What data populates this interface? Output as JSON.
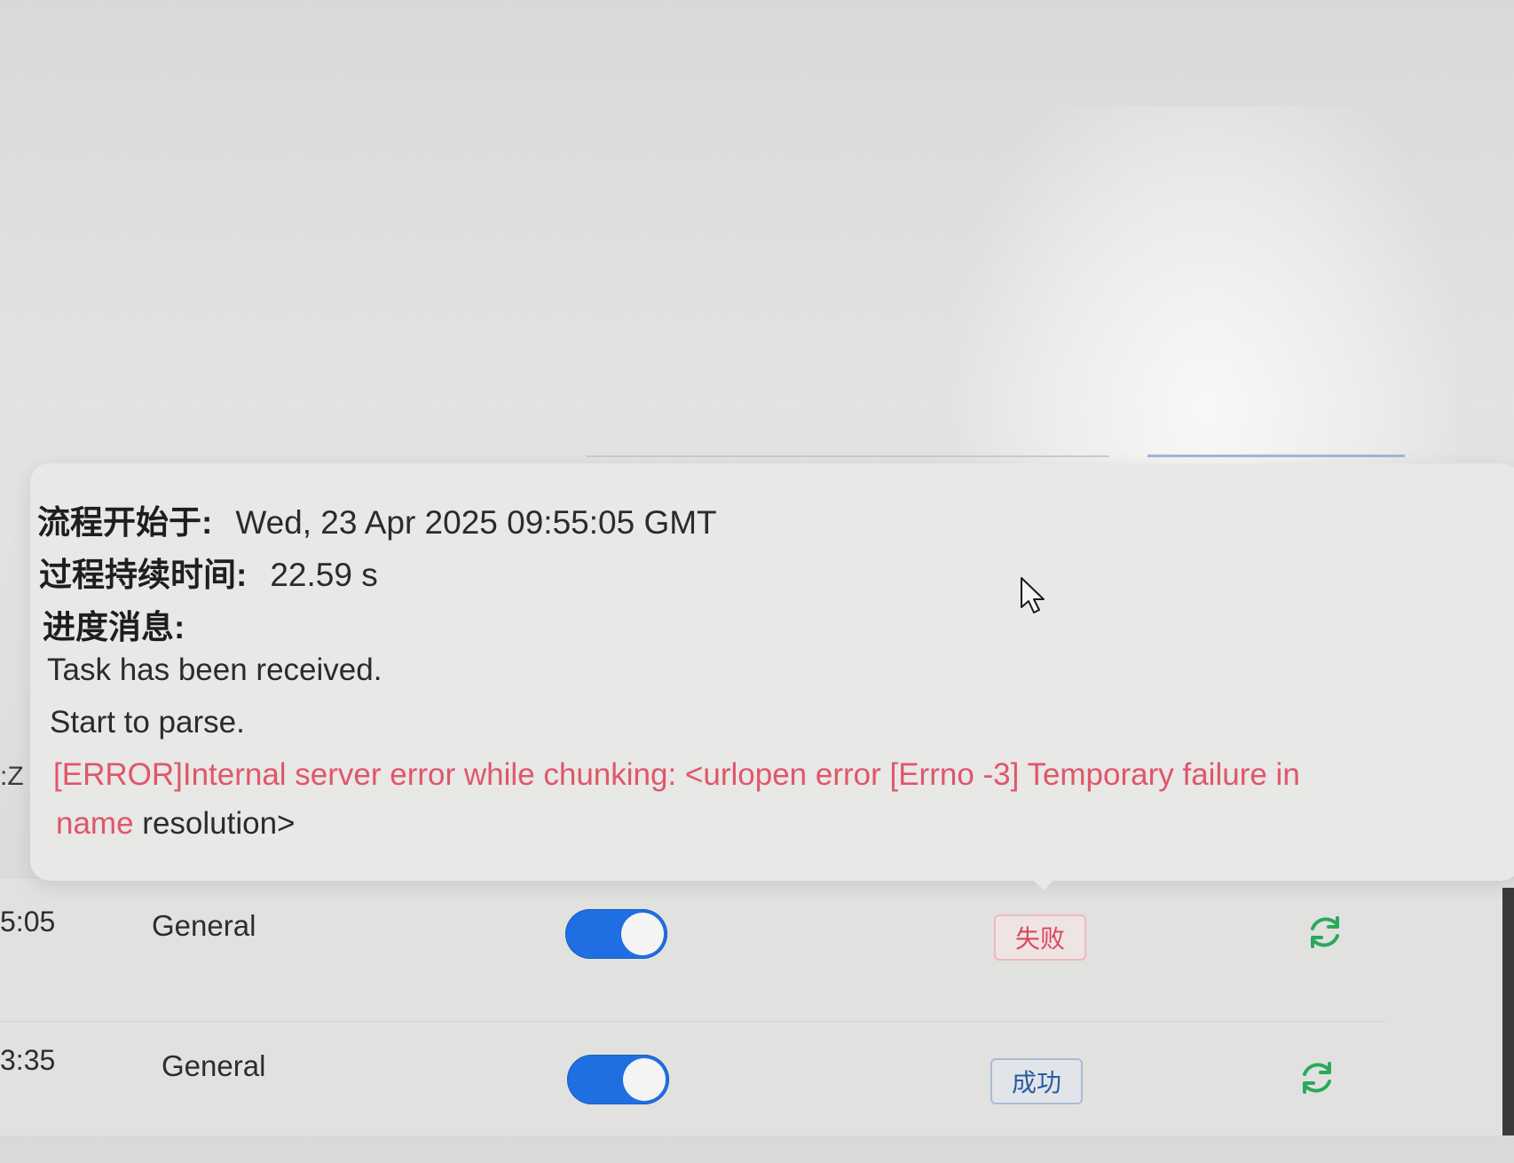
{
  "popover": {
    "start_label": "流程开始于:",
    "start_value": "Wed, 23 Apr 2025 09:55:05 GMT",
    "duration_label": "过程持续时间:",
    "duration_value": "22.59 s",
    "progress_label": "进度消息:",
    "messages": [
      "Task has been received.",
      "Start to parse."
    ],
    "error_line_1": "[ERROR]Internal server error while chunking: <urlopen error [Errno -3] Temporary failure in",
    "error_line_2_red": "name",
    "error_line_2_rest": " resolution>"
  },
  "left_cut_text": ":Z",
  "rows": [
    {
      "time": "5:05",
      "parser": "General",
      "enabled": true,
      "status": "失败",
      "status_color": "#d9485a",
      "action_icon": "refresh-icon"
    },
    {
      "time": "3:35",
      "parser": "General",
      "enabled": true,
      "status": "成功",
      "status_color": "#2a5c9c",
      "action_icon": "refresh-icon"
    }
  ],
  "colors": {
    "error_text": "#e0566a",
    "toggle_on": "#1f6fe3",
    "refresh_icon": "#2aa85c"
  }
}
